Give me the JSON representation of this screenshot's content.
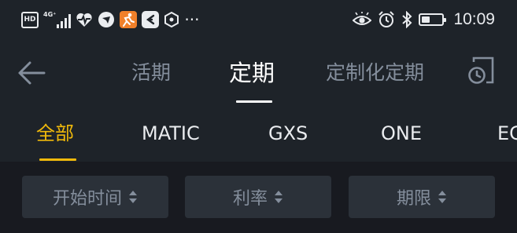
{
  "status_bar": {
    "hd_badge": "HD",
    "network_label": "4G⁺",
    "more_indicator": "···",
    "time": "10:09",
    "battery_level_percent": 40,
    "icons": [
      "hd-icon",
      "signal-icon",
      "health-heart-icon",
      "app-notification-icon",
      "running-app-icon",
      "app-e-icon",
      "hexagon-app-icon",
      "eye-comfort-icon",
      "alarm-icon",
      "bluetooth-icon",
      "battery-icon"
    ]
  },
  "header": {
    "back_icon": "arrow-left-icon",
    "tabs": [
      {
        "label": "活期",
        "active": false
      },
      {
        "label": "定期",
        "active": true
      },
      {
        "label": "定制化定期",
        "active": false
      }
    ],
    "history_icon": "clock-history-icon"
  },
  "coin_filter": {
    "items": [
      {
        "label": "全部",
        "active": true
      },
      {
        "label": "MATIC",
        "active": false
      },
      {
        "label": "GXS",
        "active": false
      },
      {
        "label": "ONE",
        "active": false
      },
      {
        "label": "EG",
        "active": false
      }
    ]
  },
  "sort_bar": {
    "buttons": [
      {
        "label": "开始时间"
      },
      {
        "label": "利率"
      },
      {
        "label": "期限"
      }
    ],
    "sort_icon": "sort-updown-icon"
  },
  "colors": {
    "background": "#1e2329",
    "sort_background": "#181a20",
    "button_background": "#2b3139",
    "accent": "#f0b90b",
    "active_text": "#ffffff",
    "inactive_text": "#848e9c"
  }
}
